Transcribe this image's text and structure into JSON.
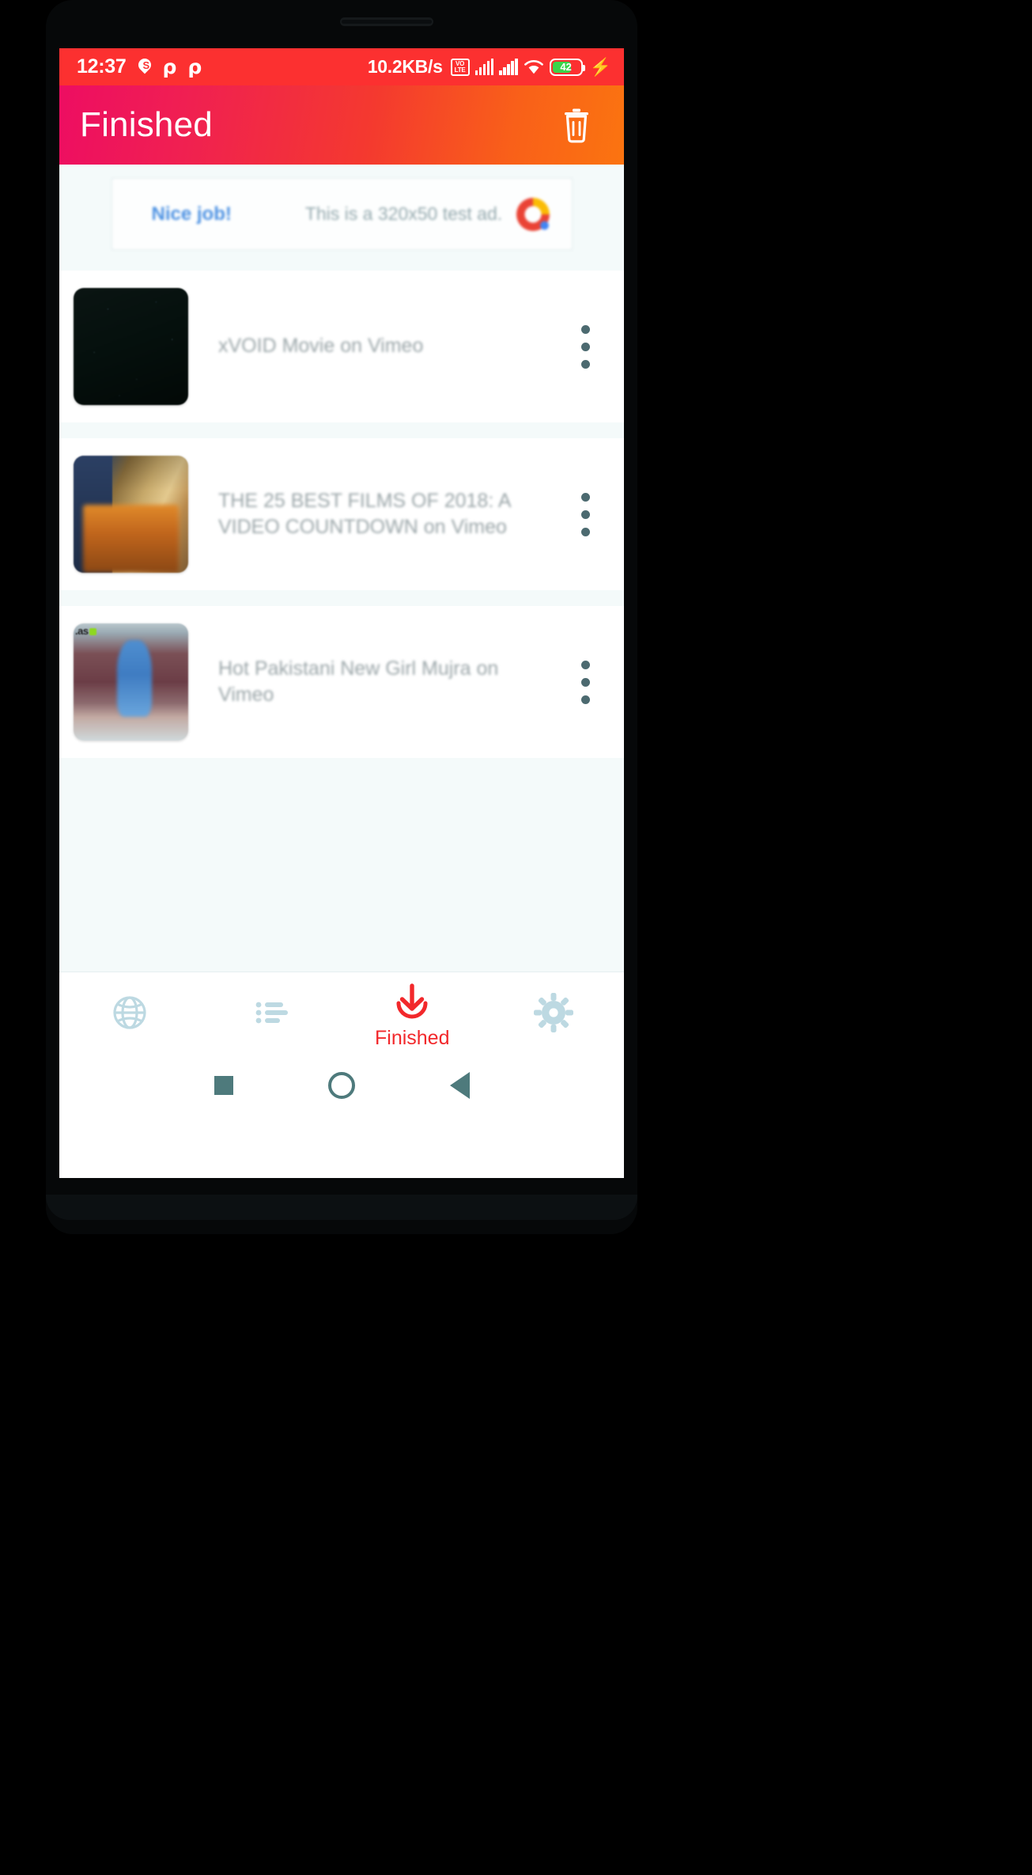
{
  "status_bar": {
    "time": "12:37",
    "notification_icons": [
      "location-pin-s-icon",
      "rho-icon",
      "rho-icon"
    ],
    "network_speed": "10.2KB/s",
    "volte_line1": "VO",
    "volte_line2": "LTE",
    "signal_icons": [
      "signal-bars-icon",
      "signal-bars-icon"
    ],
    "wifi_icon": "wifi-icon",
    "battery_percent": "42",
    "charging_icon": "lightning-bolt-icon",
    "background_color": "#fc3030"
  },
  "app_bar": {
    "title": "Finished",
    "delete_icon": "trash-icon",
    "gradient_start": "#ed0d62",
    "gradient_end": "#fb7410"
  },
  "ad_banner": {
    "cta": "Nice job!",
    "text": "This is a 320x50 test ad.",
    "logo_icon": "google-ads-logo-icon",
    "cta_color": "#4a90e2",
    "text_color": "#93a8ad"
  },
  "downloads": [
    {
      "title": "xVOID Movie on Vimeo",
      "thumb_class": "t1",
      "badge": "",
      "menu_icon": "kebab-menu-icon"
    },
    {
      "title": "THE 25 BEST FILMS OF 2018: A VIDEO COUNTDOWN on Vimeo",
      "thumb_class": "t2",
      "badge": "",
      "menu_icon": "kebab-menu-icon"
    },
    {
      "title": "Hot Pakistani New Girl Mujra on Vimeo",
      "thumb_class": "t3",
      "badge": ".as",
      "menu_icon": "kebab-menu-icon"
    }
  ],
  "tab_bar": {
    "items": [
      {
        "icon": "globe-browser-icon",
        "label": "",
        "active": false
      },
      {
        "icon": "list-downloading-icon",
        "label": "",
        "active": false
      },
      {
        "icon": "download-arrow-icon",
        "label": "Finished",
        "active": true
      },
      {
        "icon": "gear-settings-icon",
        "label": "",
        "active": false
      }
    ],
    "active_color": "#f2282b",
    "inactive_color": "#bdd9e2"
  },
  "android_nav": {
    "recents_icon": "square-recents-icon",
    "home_icon": "circle-home-icon",
    "back_icon": "triangle-back-icon",
    "color": "#4e7a7c"
  }
}
